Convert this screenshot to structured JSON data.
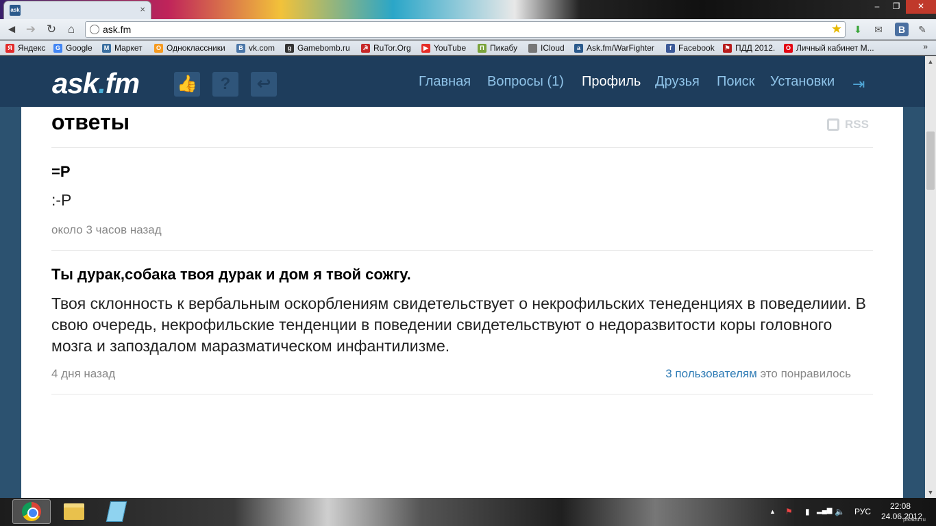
{
  "browser": {
    "tab_favicon": "ask",
    "tab_close": "×",
    "window_controls": [
      "–",
      "❐",
      "✕"
    ],
    "url": "ask.fm",
    "nav_icons": [
      "back-icon",
      "forward-icon",
      "reload-icon",
      "home-icon"
    ],
    "nav_glyphs": [
      "◄",
      "➔",
      "↻",
      "⌂"
    ],
    "star_glyph": "★",
    "extensions": [
      "⬇",
      "✉",
      "B",
      "✎"
    ],
    "bookmarks": [
      {
        "label": "Яндекс",
        "icon": "Я",
        "color": "#e22b2b"
      },
      {
        "label": "Google",
        "icon": "G",
        "color": "#4285f4"
      },
      {
        "label": "Маркет",
        "icon": "M",
        "color": "#3b6fa0"
      },
      {
        "label": "Одноклассники",
        "icon": "О",
        "color": "#f59a20"
      },
      {
        "label": "vk.com",
        "icon": "B",
        "color": "#4a76a8"
      },
      {
        "label": "Gamebomb.ru",
        "icon": "g",
        "color": "#333333"
      },
      {
        "label": "RuTor.Org",
        "icon": "☭",
        "color": "#c62828"
      },
      {
        "label": "YouTube",
        "icon": "▶",
        "color": "#e52d27"
      },
      {
        "label": "Пикабу",
        "icon": "П",
        "color": "#7aa33b"
      },
      {
        "label": "ICloud",
        "icon": "",
        "color": "#777777"
      },
      {
        "label": "Ask.fm/WarFighter",
        "icon": "a",
        "color": "#2b5a8c"
      },
      {
        "label": "Facebook",
        "icon": "f",
        "color": "#3b5998"
      },
      {
        "label": "ПДД 2012.",
        "icon": "⚑",
        "color": "#b71c1c"
      },
      {
        "label": "Личный кабинет М...",
        "icon": "O",
        "color": "#e30613"
      }
    ],
    "bookmarks_more": "»"
  },
  "site": {
    "logo_main": "ask",
    "logo_dot": ".",
    "logo_tld": "fm",
    "header_icons": [
      {
        "name": "like-icon",
        "glyph": "👍"
      },
      {
        "name": "question-icon",
        "glyph": "?"
      },
      {
        "name": "reply-icon",
        "glyph": "↩"
      }
    ],
    "nav": [
      {
        "label": "Главная",
        "active": false
      },
      {
        "label": "Вопросы (1)",
        "active": false
      },
      {
        "label": "Профиль",
        "active": true
      },
      {
        "label": "Друзья",
        "active": false
      },
      {
        "label": "Поиск",
        "active": false
      },
      {
        "label": "Установки",
        "active": false
      }
    ],
    "logout_glyph": "⇥"
  },
  "page": {
    "section_title": "ответы",
    "rss_label": "RSS",
    "answers": [
      {
        "question": "=P",
        "answer": ":-P",
        "time": "около 3 часов назад",
        "likes_link": "",
        "likes_text": ""
      },
      {
        "question": "Ты дурак,собака твоя дурак и дом я твой сожгу.",
        "answer": "Твоя склонность к вербальным оскорблениям свидетельствует о некрофильских тенеденциях в поведелиии. В свою очередь, некрофильские тенденции в поведении свидетельствуют о недоразвитости коры головного мозга и запоздалом маразматическом инфантилизме.",
        "time": "4 дня назад",
        "likes_link": "3 пользователям",
        "likes_text": " это понравилось"
      }
    ]
  },
  "taskbar": {
    "tray_up": "▲",
    "tray_flag": "⚑",
    "tray_battery": "▮",
    "tray_signal": "▂▄▆",
    "tray_volume": "🔈",
    "language": "РУС",
    "time": "22:08",
    "date": "24.06.2012"
  },
  "watermark": "pikabu.ru"
}
